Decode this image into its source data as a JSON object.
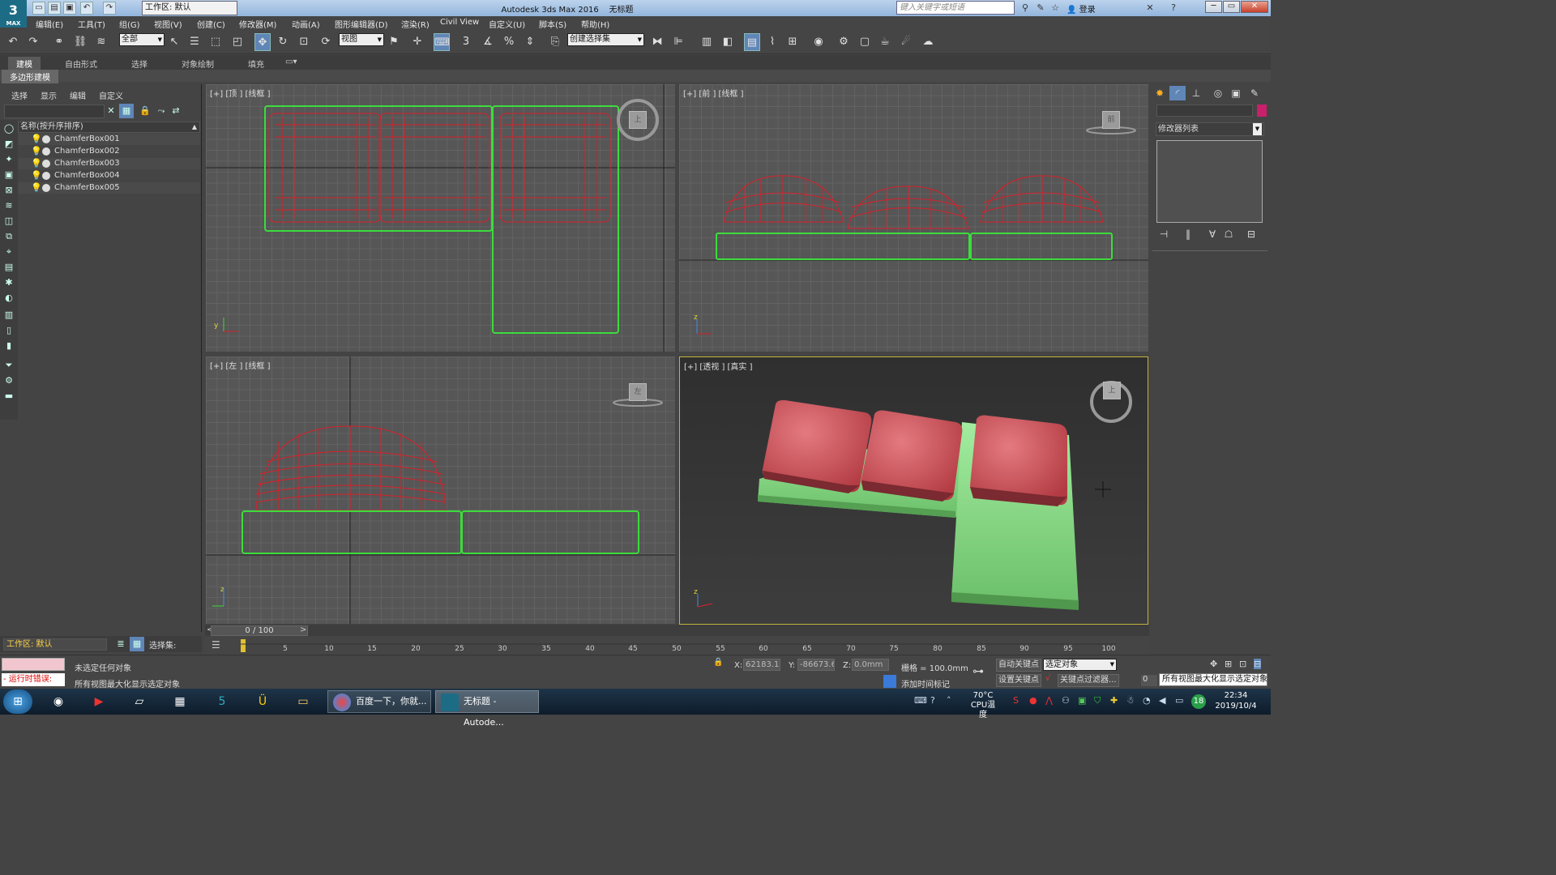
{
  "app": {
    "title": "Autodesk 3ds Max 2016",
    "doc_title": "无标题",
    "logo": "MAX",
    "workspace": "工作区: 默认",
    "search_placeholder": "键入关键字或短语",
    "login": "登录"
  },
  "menu": [
    "编辑(E)",
    "工具(T)",
    "组(G)",
    "视图(V)",
    "创建(C)",
    "修改器(M)",
    "动画(A)",
    "图形编辑器(D)",
    "渲染(R)",
    "Civil View",
    "自定义(U)",
    "脚本(S)",
    "帮助(H)"
  ],
  "toolbar": {
    "filter": "全部",
    "ref_coord": "视图",
    "named_sel": "创建选择集",
    "snap3": "3"
  },
  "ribbon": {
    "tabs": [
      "建模",
      "自由形式",
      "选择",
      "对象绘制",
      "填充"
    ],
    "active_tab": "建模",
    "sub": "多边形建模"
  },
  "scene_explorer": {
    "menu": [
      "选择",
      "显示",
      "编辑",
      "自定义"
    ],
    "column_header": "名称(按升序排序)",
    "objects": [
      "ChamferBox001",
      "ChamferBox002",
      "ChamferBox003",
      "ChamferBox004",
      "ChamferBox005"
    ],
    "workspace": "工作区: 默认",
    "selset_label": "选择集:"
  },
  "viewports": {
    "top": {
      "label": "[+] [顶 ] [线框 ]",
      "cube": "上"
    },
    "front": {
      "label": "[+] [前 ] [线框 ]",
      "cube": "前"
    },
    "left": {
      "label": "[+] [左 ] [线框 ]",
      "cube": "左"
    },
    "persp": {
      "label": "[+] [透视 ] [真实 ]",
      "cube": "上"
    }
  },
  "command_panel": {
    "modifier_list": "修改器列表"
  },
  "timeline": {
    "slider": "0 / 100",
    "ticks": [
      "5",
      "10",
      "15",
      "20",
      "25",
      "30",
      "35",
      "40",
      "45",
      "50",
      "55",
      "60",
      "65",
      "70",
      "75",
      "80",
      "85",
      "90",
      "95",
      "100"
    ]
  },
  "status": {
    "run_script": "- 运行时错误:",
    "msg1": "未选定任何对象",
    "msg2": "所有视图最大化显示选定对象",
    "x_label": "X:",
    "x_value": "62183.125",
    "y_label": "Y:",
    "y_value": "-86673.625",
    "z_label": "Z:",
    "z_value": "0.0mm",
    "grid": "栅格 = 100.0mm",
    "add_time_tag": "添加时间标记",
    "auto_key": "自动关键点",
    "set_key": "设置关键点",
    "sel_obj": "选定对象",
    "key_filters": "关键点过滤器...",
    "frame": "0",
    "tooltip": "所有视图最大化显示选定对象"
  },
  "taskbar": {
    "tasks": [
      "百度一下，你就...",
      "无标题 - Autode..."
    ],
    "cpu_temp": "70°C",
    "cpu_label": "CPU温度",
    "badge": "18",
    "time": "22:34",
    "date": "2019/10/4"
  },
  "colors": {
    "wire_red": "#d8202a",
    "wire_green": "#3cdc3c",
    "cushion_red": "#cc4a52",
    "base_green": "#8fe08f",
    "viewport_bg": "#565656"
  }
}
